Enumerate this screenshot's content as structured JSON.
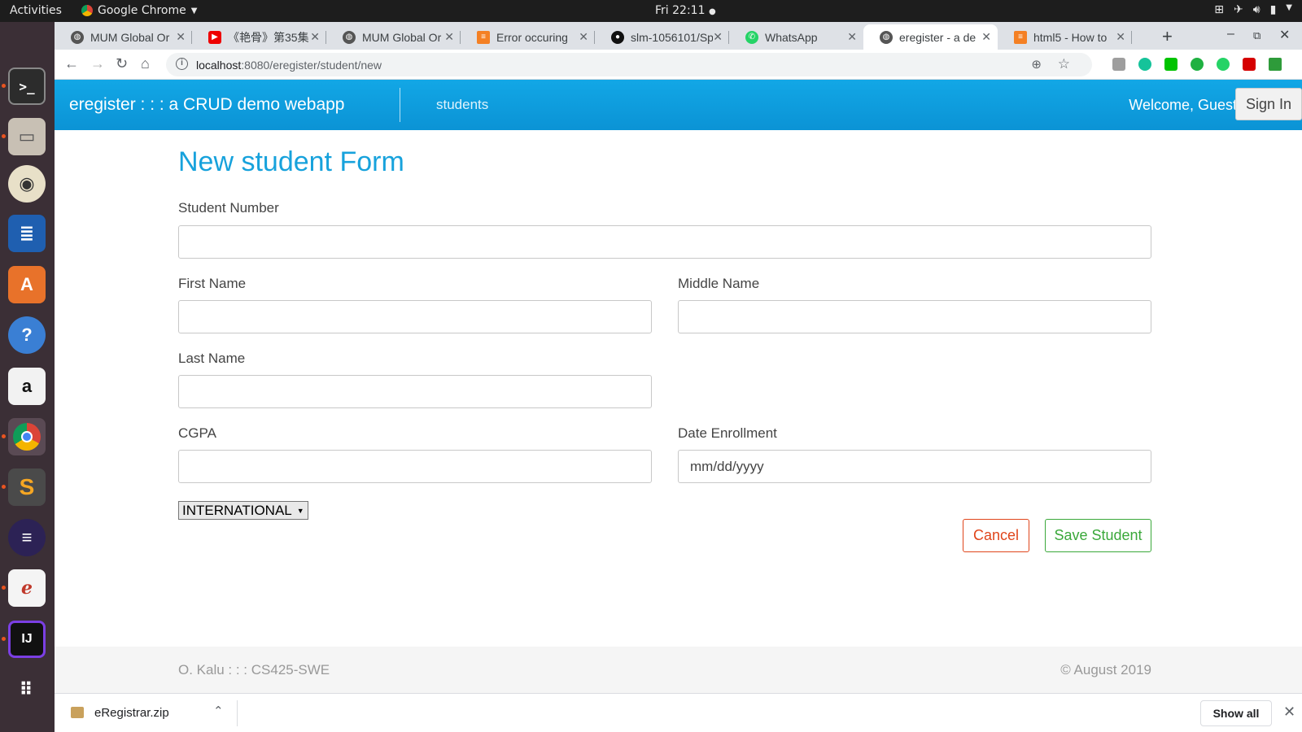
{
  "os": {
    "activities": "Activities",
    "app_name": "Google Chrome",
    "clock": "Fri 22:11"
  },
  "tabs": [
    {
      "title": "MUM Global Or",
      "favicon": "globe-icon",
      "active": false
    },
    {
      "title": "《艳骨》第35集",
      "favicon": "youtube-icon",
      "active": false
    },
    {
      "title": "MUM Global Or",
      "favicon": "globe-icon",
      "active": false
    },
    {
      "title": "Error occuring",
      "favicon": "stackoverflow-icon",
      "active": false
    },
    {
      "title": "slm-1056101/Sp",
      "favicon": "github-icon",
      "active": false
    },
    {
      "title": "WhatsApp",
      "favicon": "whatsapp-icon",
      "active": false
    },
    {
      "title": "eregister - a de",
      "favicon": "globe-icon",
      "active": true
    },
    {
      "title": "html5 - How to",
      "favicon": "stackoverflow-icon",
      "active": false
    }
  ],
  "address": {
    "host": "localhost",
    "rest": ":8080/eregister/student/new"
  },
  "navbar": {
    "brand": "eregister : : : a CRUD demo webapp",
    "link_students": "students",
    "welcome": "Welcome, Guest",
    "sign_in": "Sign In"
  },
  "form": {
    "title": "New student Form",
    "student_number_label": "Student Number",
    "student_number_value": "",
    "first_name_label": "First Name",
    "first_name_value": "",
    "middle_name_label": "Middle Name",
    "middle_name_value": "",
    "last_name_label": "Last Name",
    "last_name_value": "",
    "cgpa_label": "CGPA",
    "cgpa_value": "",
    "date_label": "Date Enrollment",
    "date_placeholder": "mm/dd/yyyy",
    "student_type_selected": "INTERNATIONAL",
    "cancel": "Cancel",
    "save": "Save Student"
  },
  "footer": {
    "left": "O. Kalu : : : CS425-SWE",
    "right": "© August 2019"
  },
  "downloads": {
    "file": "eRegistrar.zip",
    "show_all": "Show all"
  },
  "colors": {
    "navbar": "#0b93d5",
    "title": "#17a2dc",
    "cancel": "#e0451b",
    "save": "#3aa83a"
  }
}
